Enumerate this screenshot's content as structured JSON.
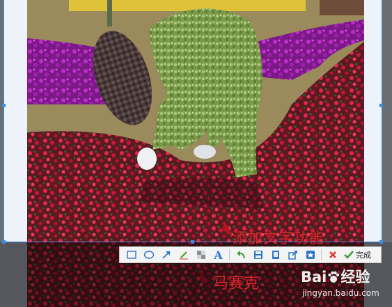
{
  "toolbar": {
    "tools": [
      {
        "name": "rectangle-tool",
        "icon": "rectangle-icon"
      },
      {
        "name": "ellipse-tool",
        "icon": "ellipse-icon"
      },
      {
        "name": "arrow-tool",
        "icon": "arrow-icon"
      },
      {
        "name": "pen-tool",
        "icon": "pen-icon"
      },
      {
        "name": "mosaic-tool",
        "icon": "mosaic-icon"
      },
      {
        "name": "text-tool",
        "icon": "text-icon",
        "glyph": "A"
      }
    ],
    "actions": [
      {
        "name": "undo",
        "icon": "undo-icon"
      },
      {
        "name": "save",
        "icon": "save-icon"
      },
      {
        "name": "copy",
        "icon": "copy-icon"
      },
      {
        "name": "share",
        "icon": "share-icon"
      },
      {
        "name": "pin",
        "icon": "pin-icon"
      }
    ],
    "cancel_icon": "close-icon",
    "done_label": "完成"
  },
  "annotations": {
    "top": "添加文字功能",
    "bottom": "马赛克"
  },
  "watermark": {
    "brand": "Bai",
    "brand_suffix": "经验",
    "url": "jingyan.baidu.com"
  },
  "colors": {
    "selection_border": "#3c8dde",
    "annotation_red": "#d9262b",
    "toolbar_bg": "#f4f4f4",
    "frame_bg": "#eef2fb",
    "arrow_blue": "#2c76c9",
    "pen_green": "#5ea73d",
    "cancel_red": "#e0342d",
    "done_green": "#3c9c3a"
  }
}
